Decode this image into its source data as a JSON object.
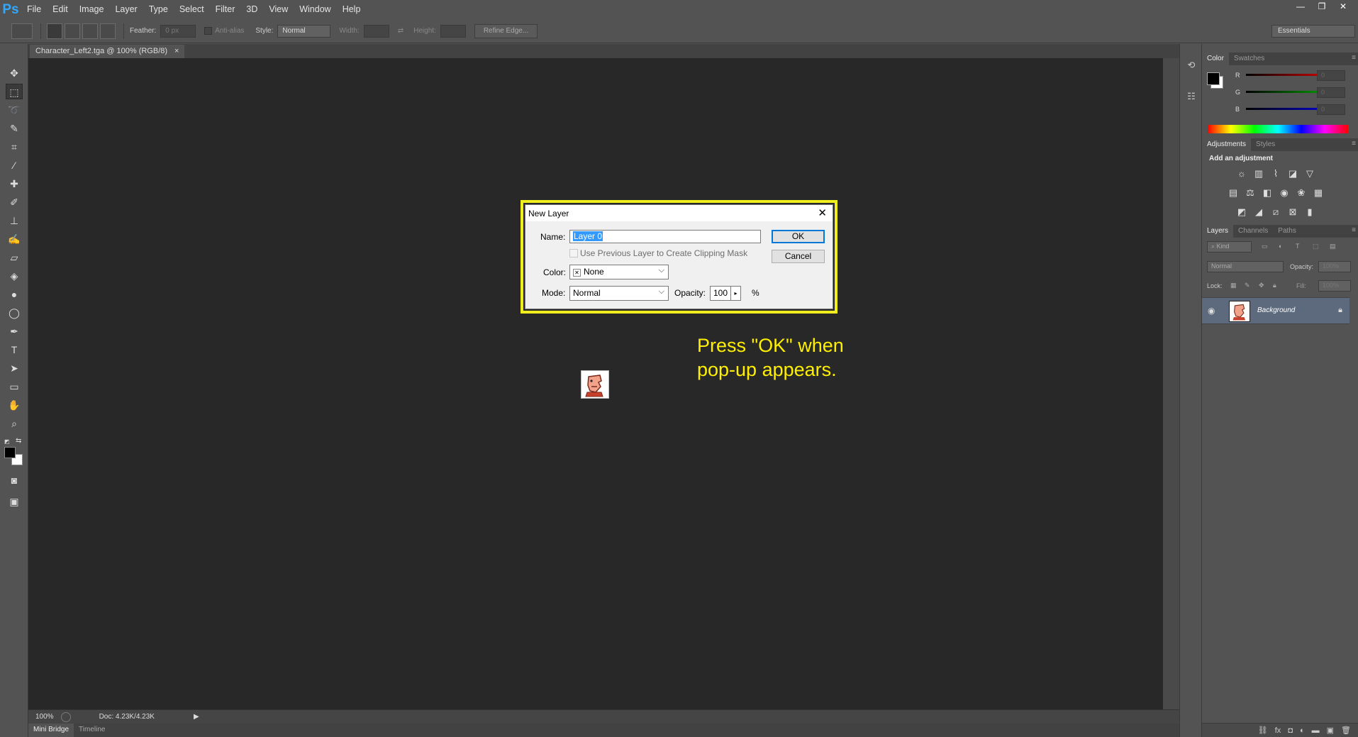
{
  "app": {
    "logo": "Ps"
  },
  "menu": [
    "File",
    "Edit",
    "Image",
    "Layer",
    "Type",
    "Select",
    "Filter",
    "3D",
    "View",
    "Window",
    "Help"
  ],
  "window_controls": [
    "—",
    "❐",
    "✕"
  ],
  "options_bar": {
    "feather_label": "Feather:",
    "feather_value": "0 px",
    "antialias_label": "Anti-alias",
    "style_label": "Style:",
    "style_value": "Normal",
    "width_label": "Width:",
    "height_label": "Height:",
    "refine_label": "Refine Edge...",
    "workspace": "Essentials"
  },
  "document": {
    "tab_title": "Character_Left2.tga @ 100% (RGB/8)",
    "tab_close": "×",
    "zoom": "100%",
    "doc_info": "Doc: 4.23K/4.23K"
  },
  "bottom_tabs": [
    "Mini Bridge",
    "Timeline"
  ],
  "annotation": "Press \"OK\" when\npop-up appears.",
  "dialog": {
    "title": "New Layer",
    "close": "✕",
    "name_label": "Name:",
    "name_value": "Layer 0",
    "clip_label": "Use Previous Layer to Create Clipping Mask",
    "color_label": "Color:",
    "color_value": "None",
    "color_x": "✕",
    "mode_label": "Mode:",
    "mode_value": "Normal",
    "opacity_label": "Opacity:",
    "opacity_value": "100",
    "percent": "%",
    "ok_label": "OK",
    "cancel_label": "Cancel"
  },
  "color_panel": {
    "tabs": [
      "Color",
      "Swatches"
    ],
    "channels": [
      {
        "label": "R",
        "value": "0",
        "color": "#ff0000"
      },
      {
        "label": "G",
        "value": "0",
        "color": "#00c000"
      },
      {
        "label": "B",
        "value": "0",
        "color": "#0000ff"
      }
    ]
  },
  "adjustments_panel": {
    "tabs": [
      "Adjustments",
      "Styles"
    ],
    "heading": "Add an adjustment"
  },
  "layers_panel": {
    "tabs": [
      "Layers",
      "Channels",
      "Paths"
    ],
    "kind_label": "Kind",
    "blend_mode": "Normal",
    "opacity_label": "Opacity:",
    "opacity_value": "100%",
    "lock_label": "Lock:",
    "fill_label": "Fill:",
    "fill_value": "100%",
    "layers": [
      {
        "name": "Background",
        "visible": true,
        "locked": true
      }
    ]
  },
  "colors": {
    "ui_bg": "#535353",
    "canvas_bg": "#282828",
    "highlight": "#f0ee1c",
    "annotation": "#ffef00",
    "selected_layer": "#5d6a7d"
  }
}
